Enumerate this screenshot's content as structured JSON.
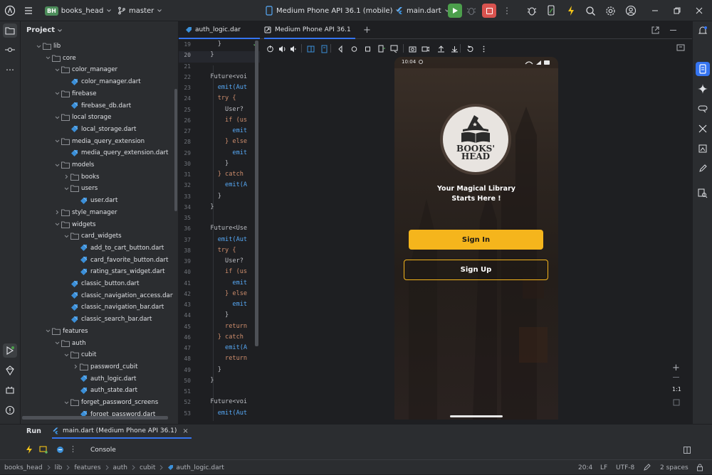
{
  "titlebar": {
    "project_badge": "BH",
    "project_name": "books_head",
    "branch": "master",
    "device": "Medium Phone API 36.1 (mobile)",
    "run_config": "main.dart"
  },
  "project_panel": {
    "title": "Project",
    "tree": [
      {
        "label": "lib",
        "depth": 0,
        "kind": "folder",
        "open": true
      },
      {
        "label": "core",
        "depth": 1,
        "kind": "folder",
        "open": true
      },
      {
        "label": "color_manager",
        "depth": 2,
        "kind": "folder",
        "open": true
      },
      {
        "label": "color_manager.dart",
        "depth": 3,
        "kind": "dart"
      },
      {
        "label": "firebase",
        "depth": 2,
        "kind": "folder",
        "open": true
      },
      {
        "label": "firebase_db.dart",
        "depth": 3,
        "kind": "dart"
      },
      {
        "label": "local storage",
        "depth": 2,
        "kind": "folder",
        "open": true
      },
      {
        "label": "local_storage.dart",
        "depth": 3,
        "kind": "dart"
      },
      {
        "label": "media_query_extension",
        "depth": 2,
        "kind": "folder",
        "open": true
      },
      {
        "label": "media_query_extension.dart",
        "depth": 3,
        "kind": "dart"
      },
      {
        "label": "models",
        "depth": 2,
        "kind": "folder",
        "open": true
      },
      {
        "label": "books",
        "depth": 3,
        "kind": "folder",
        "open": false
      },
      {
        "label": "users",
        "depth": 3,
        "kind": "folder",
        "open": true
      },
      {
        "label": "user.dart",
        "depth": 4,
        "kind": "dart"
      },
      {
        "label": "style_manager",
        "depth": 2,
        "kind": "folder",
        "open": false
      },
      {
        "label": "widgets",
        "depth": 2,
        "kind": "folder",
        "open": true
      },
      {
        "label": "card_widgets",
        "depth": 3,
        "kind": "folder",
        "open": true
      },
      {
        "label": "add_to_cart_button.dart",
        "depth": 4,
        "kind": "dart"
      },
      {
        "label": "card_favorite_button.dart",
        "depth": 4,
        "kind": "dart"
      },
      {
        "label": "rating_stars_widget.dart",
        "depth": 4,
        "kind": "dart"
      },
      {
        "label": "classic_button.dart",
        "depth": 3,
        "kind": "dart"
      },
      {
        "label": "classic_navigation_access.dart",
        "depth": 3,
        "kind": "dart"
      },
      {
        "label": "classic_navigation_bar.dart",
        "depth": 3,
        "kind": "dart"
      },
      {
        "label": "classic_search_bar.dart",
        "depth": 3,
        "kind": "dart"
      },
      {
        "label": "features",
        "depth": 1,
        "kind": "folder",
        "open": true
      },
      {
        "label": "auth",
        "depth": 2,
        "kind": "folder",
        "open": true
      },
      {
        "label": "cubit",
        "depth": 3,
        "kind": "folder",
        "open": true
      },
      {
        "label": "password_cubit",
        "depth": 4,
        "kind": "folder",
        "open": false
      },
      {
        "label": "auth_logic.dart",
        "depth": 4,
        "kind": "dart"
      },
      {
        "label": "auth_state.dart",
        "depth": 4,
        "kind": "dart"
      },
      {
        "label": "forget_password_screens",
        "depth": 3,
        "kind": "folder",
        "open": true
      },
      {
        "label": "forget_password.dart",
        "depth": 4,
        "kind": "dart"
      }
    ]
  },
  "editor": {
    "tab_label": "auth_logic.dar",
    "lines": [
      {
        "n": "19",
        "code": "    }"
      },
      {
        "n": "20",
        "code": "  }"
      },
      {
        "n": "21",
        "code": ""
      },
      {
        "n": "22",
        "code": "  Future<voi"
      },
      {
        "n": "23",
        "code": "    emit(Aut"
      },
      {
        "n": "24",
        "code": "    try {"
      },
      {
        "n": "25",
        "code": "      User?"
      },
      {
        "n": "26",
        "code": "      if (us"
      },
      {
        "n": "27",
        "code": "        emit"
      },
      {
        "n": "28",
        "code": "      } else"
      },
      {
        "n": "29",
        "code": "        emit"
      },
      {
        "n": "30",
        "code": "      }"
      },
      {
        "n": "31",
        "code": "    } catch"
      },
      {
        "n": "32",
        "code": "      emit(A"
      },
      {
        "n": "33",
        "code": "    }"
      },
      {
        "n": "34",
        "code": "  }"
      },
      {
        "n": "35",
        "code": ""
      },
      {
        "n": "36",
        "code": "  Future<Use"
      },
      {
        "n": "37",
        "code": "    emit(Aut"
      },
      {
        "n": "38",
        "code": "    try {"
      },
      {
        "n": "39",
        "code": "      User?"
      },
      {
        "n": "40",
        "code": "      if (us"
      },
      {
        "n": "41",
        "code": "        emit"
      },
      {
        "n": "42",
        "code": "      } else"
      },
      {
        "n": "43",
        "code": "        emit"
      },
      {
        "n": "44",
        "code": "      }"
      },
      {
        "n": "45",
        "code": "      return"
      },
      {
        "n": "46",
        "code": "    } catch"
      },
      {
        "n": "47",
        "code": "      emit(A"
      },
      {
        "n": "48",
        "code": "      return"
      },
      {
        "n": "49",
        "code": "    }"
      },
      {
        "n": "50",
        "code": "  }"
      },
      {
        "n": "51",
        "code": ""
      },
      {
        "n": "52",
        "code": "  Future<voi"
      },
      {
        "n": "53",
        "code": "    emit(Aut"
      }
    ]
  },
  "running_devices": {
    "tab_label": "Medium Phone API 36.1",
    "zoom_label": "1:1"
  },
  "phone": {
    "time": "10:04",
    "logo_line1": "BOOKS'",
    "logo_line2": "HEAD",
    "tagline_line1": "Your Magical Library",
    "tagline_line2": "Starts Here !",
    "sign_in": "Sign In",
    "sign_up": "Sign Up",
    "accent": "#f5b51c"
  },
  "run_panel": {
    "tab_run": "Run",
    "tab_config": "main.dart (Medium Phone API 36.1)",
    "console": "Console"
  },
  "statusbar": {
    "crumbs": [
      "books_head",
      "lib",
      "features",
      "auth",
      "cubit",
      "auth_logic.dart"
    ],
    "position": "20:4",
    "line_sep": "LF",
    "encoding": "UTF-8",
    "indent": "2 spaces"
  },
  "colors": {
    "run_green": "#4c9f4c",
    "stop_red": "#d9534f",
    "folder": "#8c8f94",
    "dart_blue": "#3b8fd8"
  }
}
